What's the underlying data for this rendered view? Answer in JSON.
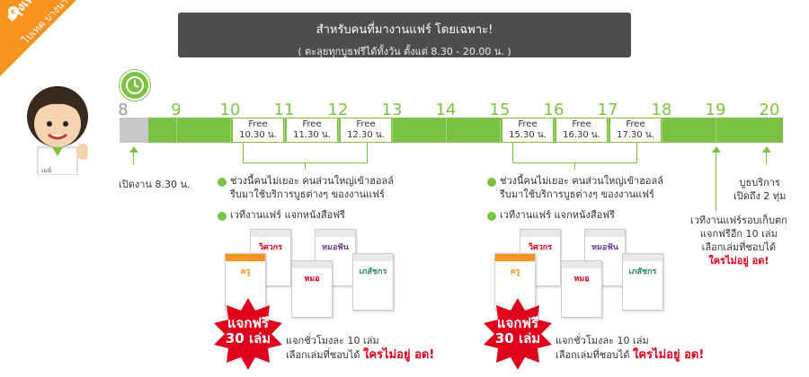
{
  "corner": {
    "city": "กรุงเทพฯ",
    "sub": "ไบเทค บางนา"
  },
  "banner": {
    "title": "สำหรับคนที่มางานแฟร์ โดยเฉพาะ!",
    "subtitle": "( ตะลุยทุกบูธฟรีได้ทั้งวัน ตั้งแต่ 8.30 - 20.00 น. )"
  },
  "mascot": {
    "badge": "เมย์"
  },
  "timeline": {
    "hours": [
      "8",
      "9",
      "10",
      "11",
      "12",
      "13",
      "14",
      "15",
      "16",
      "17",
      "18",
      "19",
      "20"
    ],
    "free_slots_left": [
      {
        "label": "Free",
        "time": "10.30 น."
      },
      {
        "label": "Free",
        "time": "11.30 น."
      },
      {
        "label": "Free",
        "time": "12.30 น."
      }
    ],
    "free_slots_right": [
      {
        "label": "Free",
        "time": "15.30 น."
      },
      {
        "label": "Free",
        "time": "16.30 น."
      },
      {
        "label": "Free",
        "time": "17.30 น."
      }
    ],
    "open_label": "เปิดงาน 8.30 น.",
    "close_line1": "บูธบริการ",
    "close_line2": "เปิดถึง 2 ทุ่ม"
  },
  "left_notes": {
    "note1_line1": "ช่วงนี้คนไม่เยอะ คนส่วนใหญ่เข้าฮอลล์",
    "note1_line2": "รีบมาใช้บริการบูธต่างๆ ของงานแฟร์",
    "note2": "เวทีงานแฟร์ แจกหนังสือฟรี"
  },
  "right_notes": {
    "note1_line1": "ช่วงนี้คนไม่เยอะ คนส่วนใหญ่เข้าฮอลล์",
    "note1_line2": "รีบมาใช้บริการบูธต่างๆ ของงานแฟร์",
    "note2": "เวทีงานแฟร์ แจกหนังสือฟรี"
  },
  "books": [
    "วิศวกร",
    "หมอฟัน",
    "ครู",
    "หมอ",
    "เภสัชกร"
  ],
  "burst": {
    "line1": "แจกฟรี",
    "line2": "30 เล่ม"
  },
  "giveaway": {
    "line1": "แจกชั่วโมงละ 10 เล่ม",
    "line2_prefix": "เลือกเล่มที่ชอบได้",
    "line2_red": "ใครไม่อยู่ อด!"
  },
  "evening": {
    "line1": "เวทีงานแฟร์รอบเก็บตก",
    "line2": "แจกฟรีอีก 10 เล่ม",
    "line3": "เลือกเล่มที่ชอบได้",
    "line4": "ใครไม่อยู่ อด!"
  },
  "colors": {
    "green": "#7cc242",
    "orange": "#f7931e",
    "banner": "#4d4d4d",
    "red": "#e1001b"
  }
}
